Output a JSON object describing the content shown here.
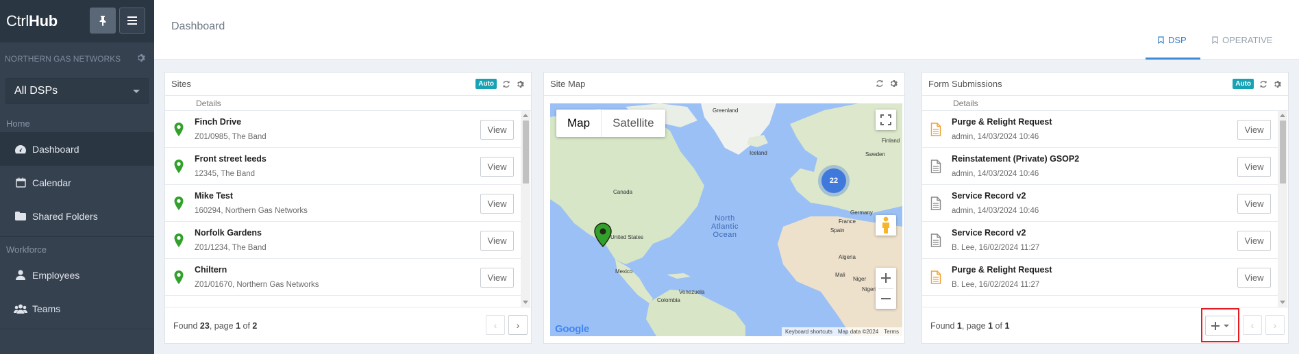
{
  "brand": {
    "prefix": "Ctrl",
    "bold": "Hub"
  },
  "sidebar": {
    "org": "NORTHERN GAS NETWORKS",
    "dsp_select": "All DSPs",
    "sections": [
      {
        "title": "Home",
        "items": [
          {
            "label": "Dashboard",
            "icon": "dashboard-icon",
            "active": true
          },
          {
            "label": "Calendar",
            "icon": "calendar-icon"
          },
          {
            "label": "Shared Folders",
            "icon": "folder-icon"
          }
        ]
      },
      {
        "title": "Workforce",
        "items": [
          {
            "label": "Employees",
            "icon": "user-icon"
          },
          {
            "label": "Teams",
            "icon": "users-icon"
          }
        ]
      }
    ]
  },
  "header": {
    "title": "Dashboard",
    "tabs": [
      {
        "label": "DSP",
        "active": true
      },
      {
        "label": "OPERATIVE"
      }
    ]
  },
  "sites": {
    "title": "Sites",
    "badge": "Auto",
    "column": "Details",
    "rows": [
      {
        "title": "Finch Drive",
        "sub": "Z01/0985, The Band"
      },
      {
        "title": "Front street leeds",
        "sub": "12345, The Band"
      },
      {
        "title": "Mike Test",
        "sub": "160294, Northern Gas Networks"
      },
      {
        "title": "Norfolk Gardens",
        "sub": "Z01/1234, The Band"
      },
      {
        "title": "Chiltern",
        "sub": "Z01/01670, Northern Gas Networks"
      }
    ],
    "view_label": "View",
    "found": {
      "prefix": "Found ",
      "count": "23",
      "mid": ", page ",
      "page": "1",
      "of": " of ",
      "pages": "2"
    }
  },
  "map": {
    "title": "Site Map",
    "type_map": "Map",
    "type_satellite": "Satellite",
    "cluster_count": "22",
    "labels": {
      "greenland": "Greenland",
      "iceland": "Iceland",
      "finland": "Finland",
      "sweden": "Sweden",
      "canada": "Canada",
      "us": "United States",
      "mexico": "Mexico",
      "germany": "Germany",
      "france": "France",
      "spain": "Spain",
      "algeria": "Algeria",
      "mali": "Mali",
      "niger": "Niger",
      "nigeria": "Nigeria",
      "venezuela": "Venezuela",
      "colombia": "Colombia",
      "ocean": "North Atlantic Ocean"
    },
    "footer": {
      "shortcuts": "Keyboard shortcuts",
      "data": "Map data ©2024",
      "terms": "Terms"
    },
    "google": "Google"
  },
  "forms": {
    "title": "Form Submissions",
    "badge": "Auto",
    "column": "Details",
    "rows": [
      {
        "title": "Purge & Relight Request",
        "sub": "admin, 14/03/2024 10:46",
        "color": "#f0a030"
      },
      {
        "title": "Reinstatement (Private) GSOP2",
        "sub": "admin, 14/03/2024 10:46",
        "color": "#888888"
      },
      {
        "title": "Service Record v2",
        "sub": "admin, 14/03/2024 10:46",
        "color": "#888888"
      },
      {
        "title": "Service Record v2",
        "sub": "B. Lee, 16/02/2024 11:27",
        "color": "#888888"
      },
      {
        "title": "Purge & Relight Request",
        "sub": "B. Lee, 16/02/2024 11:27",
        "color": "#f0a030"
      }
    ],
    "view_label": "View",
    "found": {
      "prefix": "Found ",
      "count": "1",
      "mid": ", page ",
      "page": "1",
      "of": " of ",
      "pages": "1"
    }
  },
  "colors": {
    "accent": "#3f8ad6",
    "auto_badge": "#18a3b4",
    "marker_green": "#33a02c",
    "highlight": "#e51b24"
  }
}
